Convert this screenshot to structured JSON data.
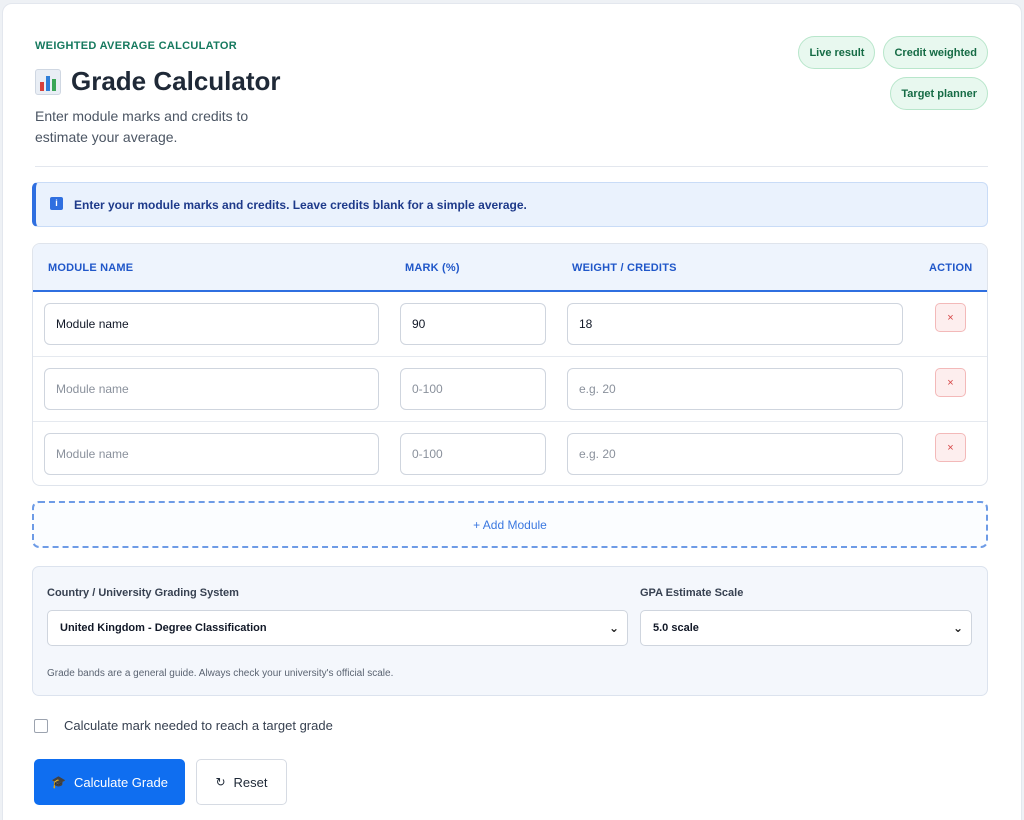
{
  "header": {
    "eyebrow": "WEIGHTED AVERAGE CALCULATOR",
    "title": "Grade Calculator",
    "title_icon": "bar-chart-icon",
    "subtitle": "Enter module marks and credits to estimate your average.",
    "chips": [
      "Live result",
      "Credit weighted",
      "Target planner"
    ]
  },
  "info": {
    "icon": "info-icon",
    "text": "Enter your module marks and credits. Leave credits blank for a simple average."
  },
  "table": {
    "columns": [
      "MODULE NAME",
      "MARK (%)",
      "WEIGHT / CREDITS",
      "ACTION"
    ],
    "rows": [
      {
        "name": "Module name",
        "mark": "90",
        "weight": "18"
      },
      {
        "name": "",
        "mark": "",
        "weight": ""
      },
      {
        "name": "",
        "mark": "",
        "weight": ""
      }
    ],
    "placeholders": {
      "name": "Module name",
      "mark": "0-100",
      "weight": "e.g. 20"
    },
    "delete_label": "×"
  },
  "add_module_label": "+ Add Module",
  "settings": {
    "grading_label": "Country / University Grading System",
    "grading_value": "United Kingdom - Degree Classification",
    "gpa_label": "GPA Estimate Scale",
    "gpa_value": "5.0 scale",
    "hint": "Grade bands are a general guide. Always check your university's official scale."
  },
  "target": {
    "checked": false,
    "label": "Calculate mark needed to reach a target grade"
  },
  "buttons": {
    "calculate_icon": "graduation-cap-icon",
    "calculate": "Calculate Grade",
    "reset_icon": "refresh-icon",
    "reset": "Reset"
  },
  "colors": {
    "accent": "#0f6ef0",
    "header_blue": "#2057c9",
    "eyebrow_green": "#15795e",
    "chip_bg": "#e8f8ef",
    "delete_red": "#d64545"
  }
}
